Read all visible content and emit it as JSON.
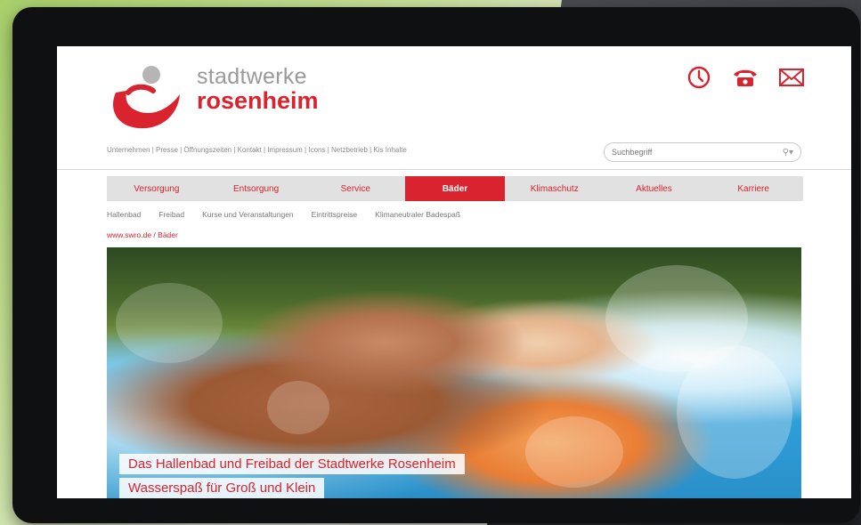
{
  "logo": {
    "line1": "stadtwerke",
    "line2": "rosenheim"
  },
  "header_icons": [
    "clock-icon",
    "phone-icon",
    "mail-icon"
  ],
  "toplinks": "Unternehmen | Presse | Öffnungszeiten | Kontakt | Impressum | Icons | Netzbetrieb | Kis Inhalte",
  "search": {
    "placeholder": "Suchbegriff"
  },
  "nav": {
    "items": [
      {
        "label": "Versorgung",
        "active": false
      },
      {
        "label": "Entsorgung",
        "active": false
      },
      {
        "label": "Service",
        "active": false
      },
      {
        "label": "Bäder",
        "active": true
      },
      {
        "label": "Klimaschutz",
        "active": false
      },
      {
        "label": "Aktuelles",
        "active": false
      },
      {
        "label": "Karriere",
        "active": false
      }
    ]
  },
  "subnav": [
    "Hallenbad",
    "Freibad",
    "Kurse und Veranstaltungen",
    "Eintrittspreise",
    "Klimaneutraler Badespaß"
  ],
  "breadcrumb": "www.swro.de / Bäder",
  "hero": {
    "line1": "Das Hallenbad und Freibad der Stadtwerke Rosenheim",
    "line2": "Wasserspaß für Groß und Klein"
  },
  "colors": {
    "brand": "#d9232e",
    "nav_bg": "#e1e1e1"
  }
}
